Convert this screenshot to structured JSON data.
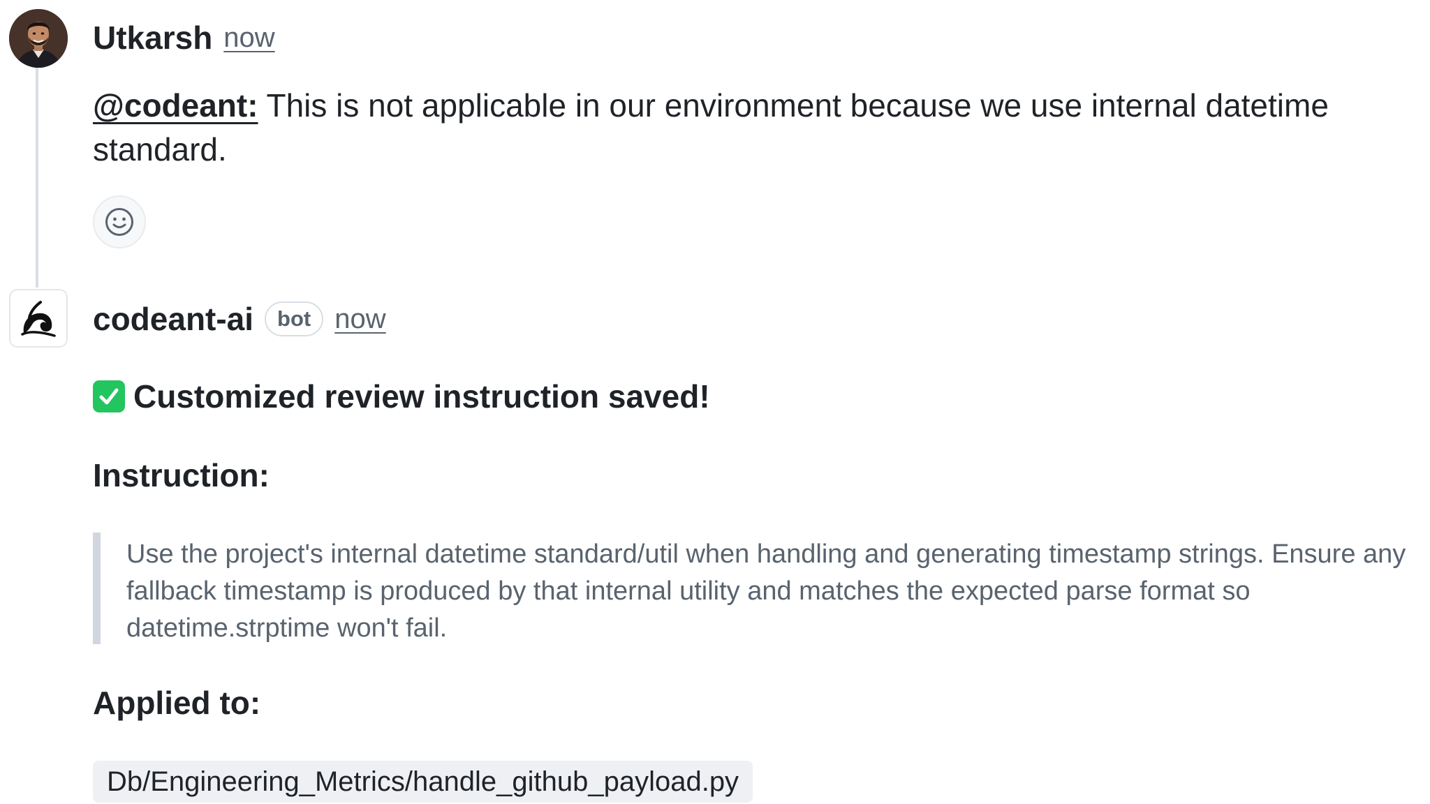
{
  "comment_user": {
    "author": "Utkarsh",
    "time": "now",
    "mention": "@codeant:",
    "body": " This is not applicable in our environment because we use internal datetime standard.",
    "avatar_icon": "user-photo-avatar",
    "reaction_icon": "smiley-icon"
  },
  "comment_bot": {
    "author": "codeant-ai",
    "badge": "bot",
    "time": "now",
    "avatar_icon": "codeant-logo",
    "status_icon": "check-mark-emoji",
    "status_title": "Customized review instruction saved!",
    "instruction_heading": "Instruction:",
    "instruction_text": "Use the project's internal datetime standard/util when handling and generating timestamp strings. Ensure any fallback timestamp is produced by that internal utility and matches the expected parse format so datetime.strptime won't fail.",
    "applied_heading": "Applied to:",
    "applied_path": "Db/Engineering_Metrics/handle_github_payload.py"
  },
  "colors": {
    "text_primary": "#1f2328",
    "text_muted": "#59636e",
    "check_green": "#22c55e",
    "quote_border": "#d0d7de",
    "code_bg": "#eef0f3"
  }
}
